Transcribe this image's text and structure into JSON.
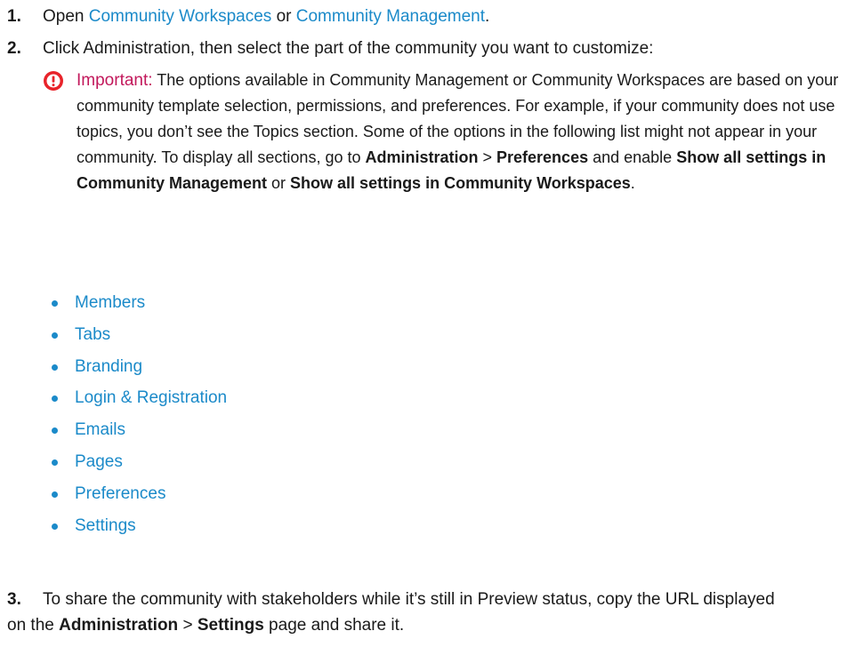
{
  "steps": [
    {
      "number": "1.",
      "prefix": "Open ",
      "link1": "Community Workspaces",
      "middle": " or ",
      "link2": "Community Management",
      "suffix": "."
    },
    {
      "number": "2.",
      "text": "Click Administration, then select the part of the community you want to customize:"
    },
    {
      "number": "3.",
      "line1": "To share the community with stakeholders while it’s still in Preview status, copy the URL displayed",
      "line2_prefix": "on the ",
      "bold1": "Administration",
      "sep": " > ",
      "bold2": "Settings",
      "line2_suffix": " page and share it."
    }
  ],
  "note": {
    "label": "Important:",
    "text": " The options available in Community Management or Community Workspaces are based on your community template selection, permissions, and preferences. For example, if your community does not use topics, you don’t see the Topics section. Some of the options in the following list might not appear in your community. To display all sections, go to ",
    "b1": "Administration",
    "sep": " > ",
    "b2": "Preferences",
    "mid": " and enable ",
    "b3": "Show all settings in Community Management",
    "or": " or ",
    "b4": "Show all settings in Community Workspaces",
    "end": "."
  },
  "links": [
    "Members",
    "Tabs",
    "Branding",
    "Login & Registration",
    "Emails",
    "Pages",
    "Preferences",
    "Settings"
  ],
  "colors": {
    "link": "#1b8ac9",
    "important": "#c2185b",
    "icon_fill": "#e8232a"
  },
  "icons": {
    "note": "exclamation-circle-icon",
    "bullet": "bullet-dot"
  }
}
